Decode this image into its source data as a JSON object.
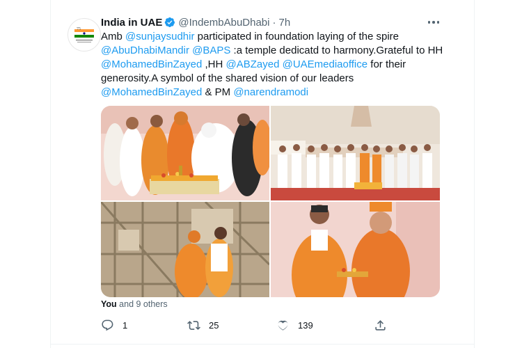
{
  "tweet": {
    "author_name": "India in UAE",
    "author_handle": "@IndembAbuDhabi",
    "separator": "·",
    "time": "7h",
    "lines": [
      [
        {
          "t": "Amb ",
          "link": false
        },
        {
          "t": "@sunjaysudhir",
          "link": true
        },
        {
          "t": " participated in foundation laying of the spire",
          "link": false
        }
      ],
      [
        {
          "t": "@AbuDhabiMandir",
          "link": true
        },
        {
          "t": " ",
          "link": false
        },
        {
          "t": "@BAPS",
          "link": true
        },
        {
          "t": " :a temple dedicatd to harmony.Grateful to HH",
          "link": false
        }
      ],
      [
        {
          "t": "@MohamedBinZayed",
          "link": true
        },
        {
          "t": " ,HH ",
          "link": false
        },
        {
          "t": "@ABZayed",
          "link": true
        },
        {
          "t": " ",
          "link": false
        },
        {
          "t": "@UAEmediaoffice",
          "link": true
        },
        {
          "t": " for their",
          "link": false
        }
      ],
      [
        {
          "t": "generosity.A symbol of the shared vision of our leaders",
          "link": false
        }
      ],
      [
        {
          "t": "@MohamedBinZayed",
          "link": true
        },
        {
          "t": " & PM ",
          "link": false
        },
        {
          "t": "@narendramodi",
          "link": true
        }
      ]
    ],
    "liked_by": {
      "you": "You",
      "rest": " and 9 others"
    },
    "actions": {
      "reply_count": "1",
      "retweet_count": "25",
      "like_count": "139"
    }
  },
  "icons": {
    "verified": "verified-badge-icon",
    "more": "more-dots-icon",
    "reply": "reply-icon",
    "retweet": "retweet-icon",
    "like": "heart-icon",
    "share": "share-icon"
  },
  "colors": {
    "link": "#1d9bf0",
    "secondary_text": "#536471",
    "saffron_robe": "#f0892a",
    "divider": "#eff3f4"
  }
}
